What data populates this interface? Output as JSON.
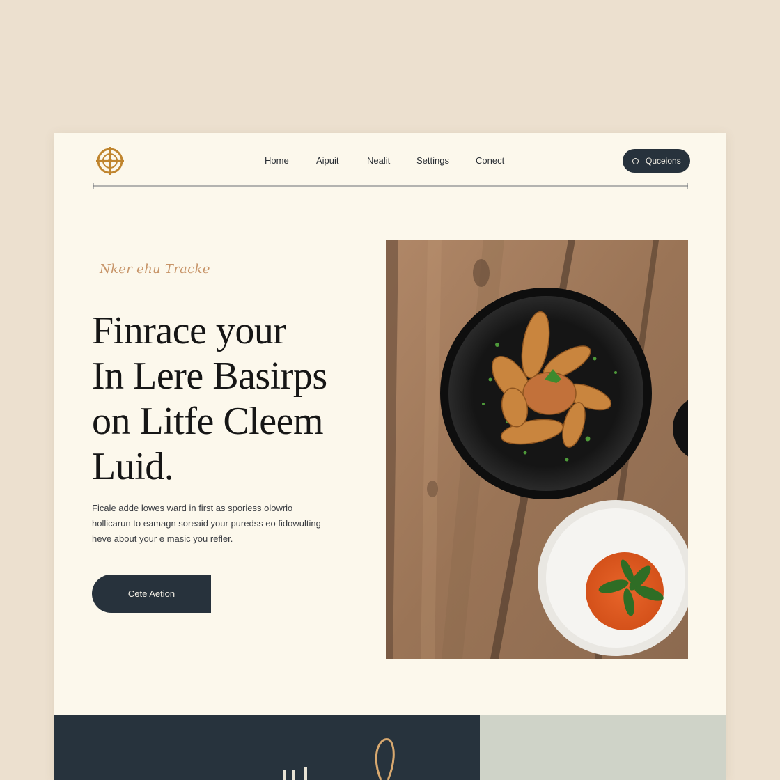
{
  "nav": {
    "items": [
      "Home",
      "Aipuit",
      "Nealit",
      "Settings",
      "Conect"
    ],
    "cta_label": "Quceions"
  },
  "hero": {
    "eyebrow": "Nker ehu Tracke",
    "headline": [
      "Finrace your",
      "In Lere Basirps",
      "on Litfe  Cleem",
      "Luid."
    ],
    "body": [
      "Ficale adde lowes ward in first as sporiess olowrio",
      "hollicarun to eamagn soreaid your puredss eo fidowulting",
      "heve about your e masic you refler."
    ],
    "cta_label": "Cete Aetion"
  },
  "colors": {
    "page_bg": "#ece0cf",
    "card_bg": "#fcf8ec",
    "navy": "#27323c",
    "accent_gold": "#c0852e",
    "sage": "#cfd3c8"
  },
  "icons": {
    "logo": "compass-logo-icon",
    "pill": "circle-icon"
  }
}
